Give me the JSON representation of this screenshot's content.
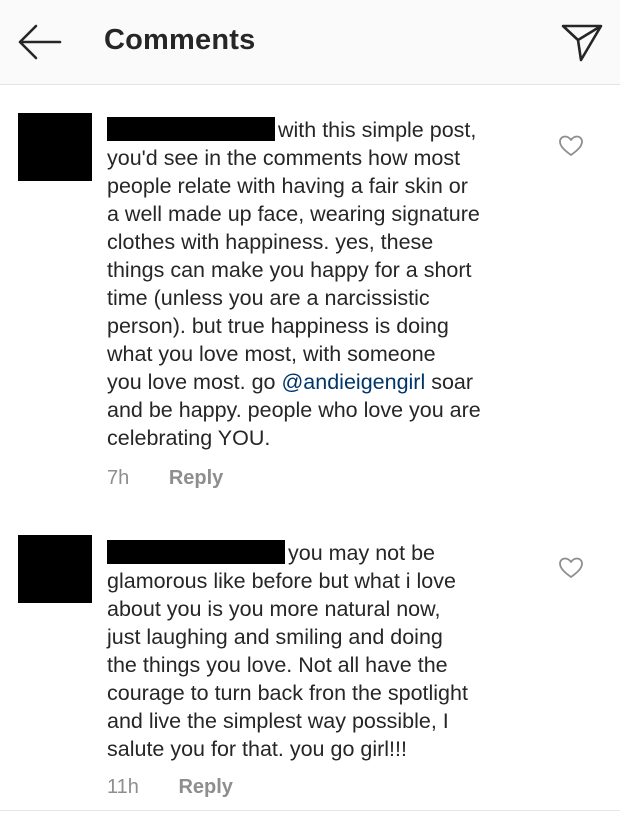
{
  "header": {
    "title": "Comments",
    "back_icon": "arrow-left-icon",
    "send_icon": "paper-plane-icon"
  },
  "comments": [
    {
      "lines": [
        "with this simple post,",
        "you'd see in the comments how most",
        "people relate with having a fair skin or",
        "a well made up face, wearing signature",
        "clothes with happiness. yes, these",
        "things can make you happy for a short",
        "time (unless you are a narcissistic",
        "person). but true happiness is doing",
        "what you love most, with someone",
        "you love most. go ",
        "and be happy. people who love you are",
        "celebrating YOU."
      ],
      "mention": "@andieigengirl",
      "after_mention": " soar",
      "time": "7h",
      "reply_label": "Reply"
    },
    {
      "lines": [
        "you may not be",
        "glamorous like before but what i love",
        "about you is you more natural now,",
        "just laughing and smiling and doing",
        "the things you love. Not all have the",
        "courage to turn back fron the spotlight",
        "and live the simplest way possible, I",
        "salute you for that. you go girl!!!"
      ],
      "time": "11h",
      "reply_label": "Reply"
    }
  ],
  "colors": {
    "mention": "#003569",
    "meta": "#8e8e8e",
    "header_bg": "#fafafa"
  }
}
